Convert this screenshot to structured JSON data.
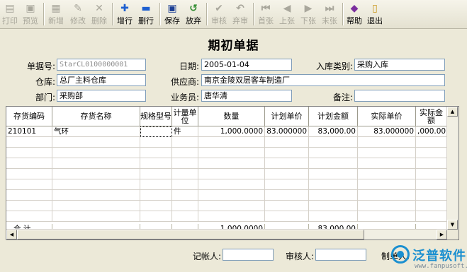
{
  "toolbar": {
    "print": "打印",
    "preview": "预览",
    "add": "新增",
    "edit": "修改",
    "delete": "删除",
    "add_row": "增行",
    "del_row": "删行",
    "save": "保存",
    "discard": "放弃",
    "approve": "审核",
    "unapprove": "弃审",
    "first": "首张",
    "prev": "上张",
    "next": "下张",
    "last": "末张",
    "help": "帮助",
    "exit": "退出"
  },
  "title": "期初单据",
  "header": {
    "doc_no_label": "单据号:",
    "doc_no": "StarCL0100000001",
    "date_label": "日期:",
    "date": "2005-01-04",
    "in_type_label": "入库类别:",
    "in_type": "采购入库",
    "warehouse_label": "仓库:",
    "warehouse": "总厂主料仓库",
    "supplier_label": "供应商:",
    "supplier": "南京金陵双层客车制造厂",
    "dept_label": "部门:",
    "dept": "采购部",
    "clerk_label": "业务员:",
    "clerk": "唐华清",
    "remark_label": "备注:",
    "remark": ""
  },
  "table": {
    "columns": [
      "存货编码",
      "存货名称",
      "规格型号",
      "计量单位",
      "数量",
      "计划单价",
      "计划金额",
      "实际单价",
      "实际金额"
    ],
    "rows": [
      {
        "code": "210101",
        "name": "气环",
        "spec": "",
        "unit": "件",
        "qty": "1,000.0000",
        "plan_price": "83.000000",
        "plan_amount": "83,000.00",
        "actual_price": "83.000000",
        "actual_amount": ",000.00"
      }
    ],
    "summary_label": "合    计",
    "summary_qty": "1,000.0000",
    "summary_plan_amount": "83,000.00"
  },
  "footer": {
    "bookkeeper_label": "记帐人:",
    "bookkeeper": "",
    "approver_label": "审核人:",
    "approver": "",
    "maker_label": "制单人:"
  },
  "watermark": {
    "name": "泛普软件",
    "url": "www.fanpusoft.com"
  },
  "colors": {
    "background": "#ece9d8",
    "input_border": "#7f9db9",
    "watermark": "#1a8fd0"
  }
}
